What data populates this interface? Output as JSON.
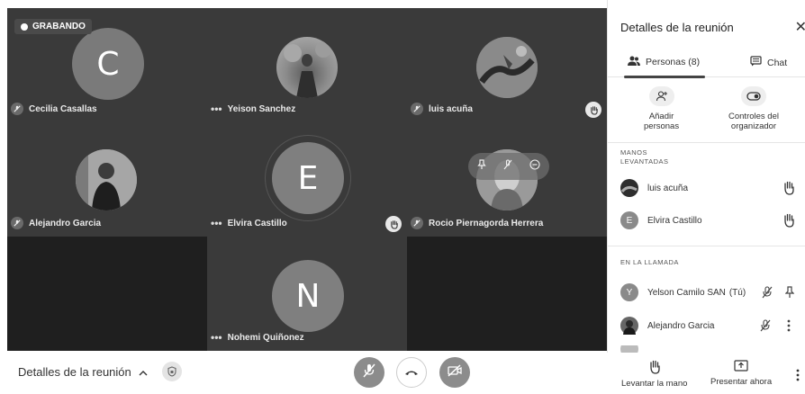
{
  "recording": {
    "label": "GRABANDO"
  },
  "tiles": [
    {
      "name": "Cecilia Casallas",
      "initial": "C",
      "indicator": "mute"
    },
    {
      "name": "Yeison Sanchez",
      "indicator": "more"
    },
    {
      "name": "luis acuña",
      "indicator": "mute",
      "hand_raised": true
    },
    {
      "name": "Alejandro Garcia",
      "indicator": "mute"
    },
    {
      "name": "Elvira Castillo",
      "initial": "E",
      "indicator": "more",
      "hand_raised": true
    },
    {
      "name": "Rocio Piernagorda Herrera",
      "indicator": "mute"
    },
    {
      "name": "Nohemi Quiñonez",
      "initial": "N",
      "indicator": "more"
    }
  ],
  "toolbar": {
    "meeting_details_label": "Detalles de la reunión",
    "raise_hand_label": "Levantar la mano",
    "present_label": "Presentar ahora"
  },
  "panel": {
    "title": "Detalles de la reunión",
    "tabs": {
      "people": "Personas (8)",
      "chat": "Chat"
    },
    "actions": {
      "add_people": [
        "Añadir",
        "personas"
      ],
      "host_controls": [
        "Controles del",
        "organizador"
      ]
    },
    "sections": {
      "raised_hands": [
        "MANOS",
        "LEVANTADAS"
      ],
      "in_call": "EN LA LLAMADA"
    },
    "raised_hands": [
      {
        "name": "luis acuña"
      },
      {
        "name": "Elvira Castillo",
        "initial": "E"
      }
    ],
    "in_call": [
      {
        "name": "Yelson Camilo SAN...",
        "tag": "(Tú)",
        "initial": "Y"
      },
      {
        "name": "Alejandro Garcia"
      }
    ]
  },
  "colors": {
    "accent_gray": "#8c8c8c",
    "tile_bg": "#3a3a3a",
    "grid_bg": "#2b2b2b"
  }
}
